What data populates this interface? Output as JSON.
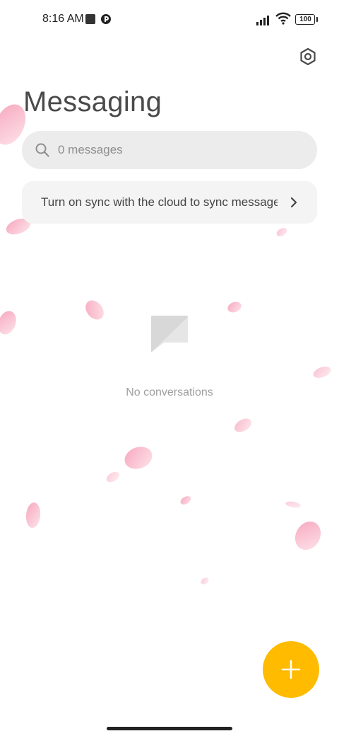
{
  "status_bar": {
    "time": "8:16 AM",
    "battery_level": "100",
    "icons": [
      "notification-square-icon",
      "app-status-icon",
      "cellular-signal-icon",
      "wifi-icon",
      "battery-icon"
    ]
  },
  "header": {
    "title": "Messaging",
    "settings_icon": "gear-icon"
  },
  "search": {
    "placeholder": "0 messages",
    "icon": "search-icon"
  },
  "sync_banner": {
    "text": "Turn on sync with the cloud to sync messages",
    "icon": "chevron-right-icon"
  },
  "empty_state": {
    "icon": "message-bubble-icon",
    "text": "No conversations"
  },
  "fab": {
    "icon": "plus-icon",
    "color": "#ffbb00"
  },
  "colors": {
    "accent": "#ffbb00",
    "petal": "#f6b8c8"
  }
}
